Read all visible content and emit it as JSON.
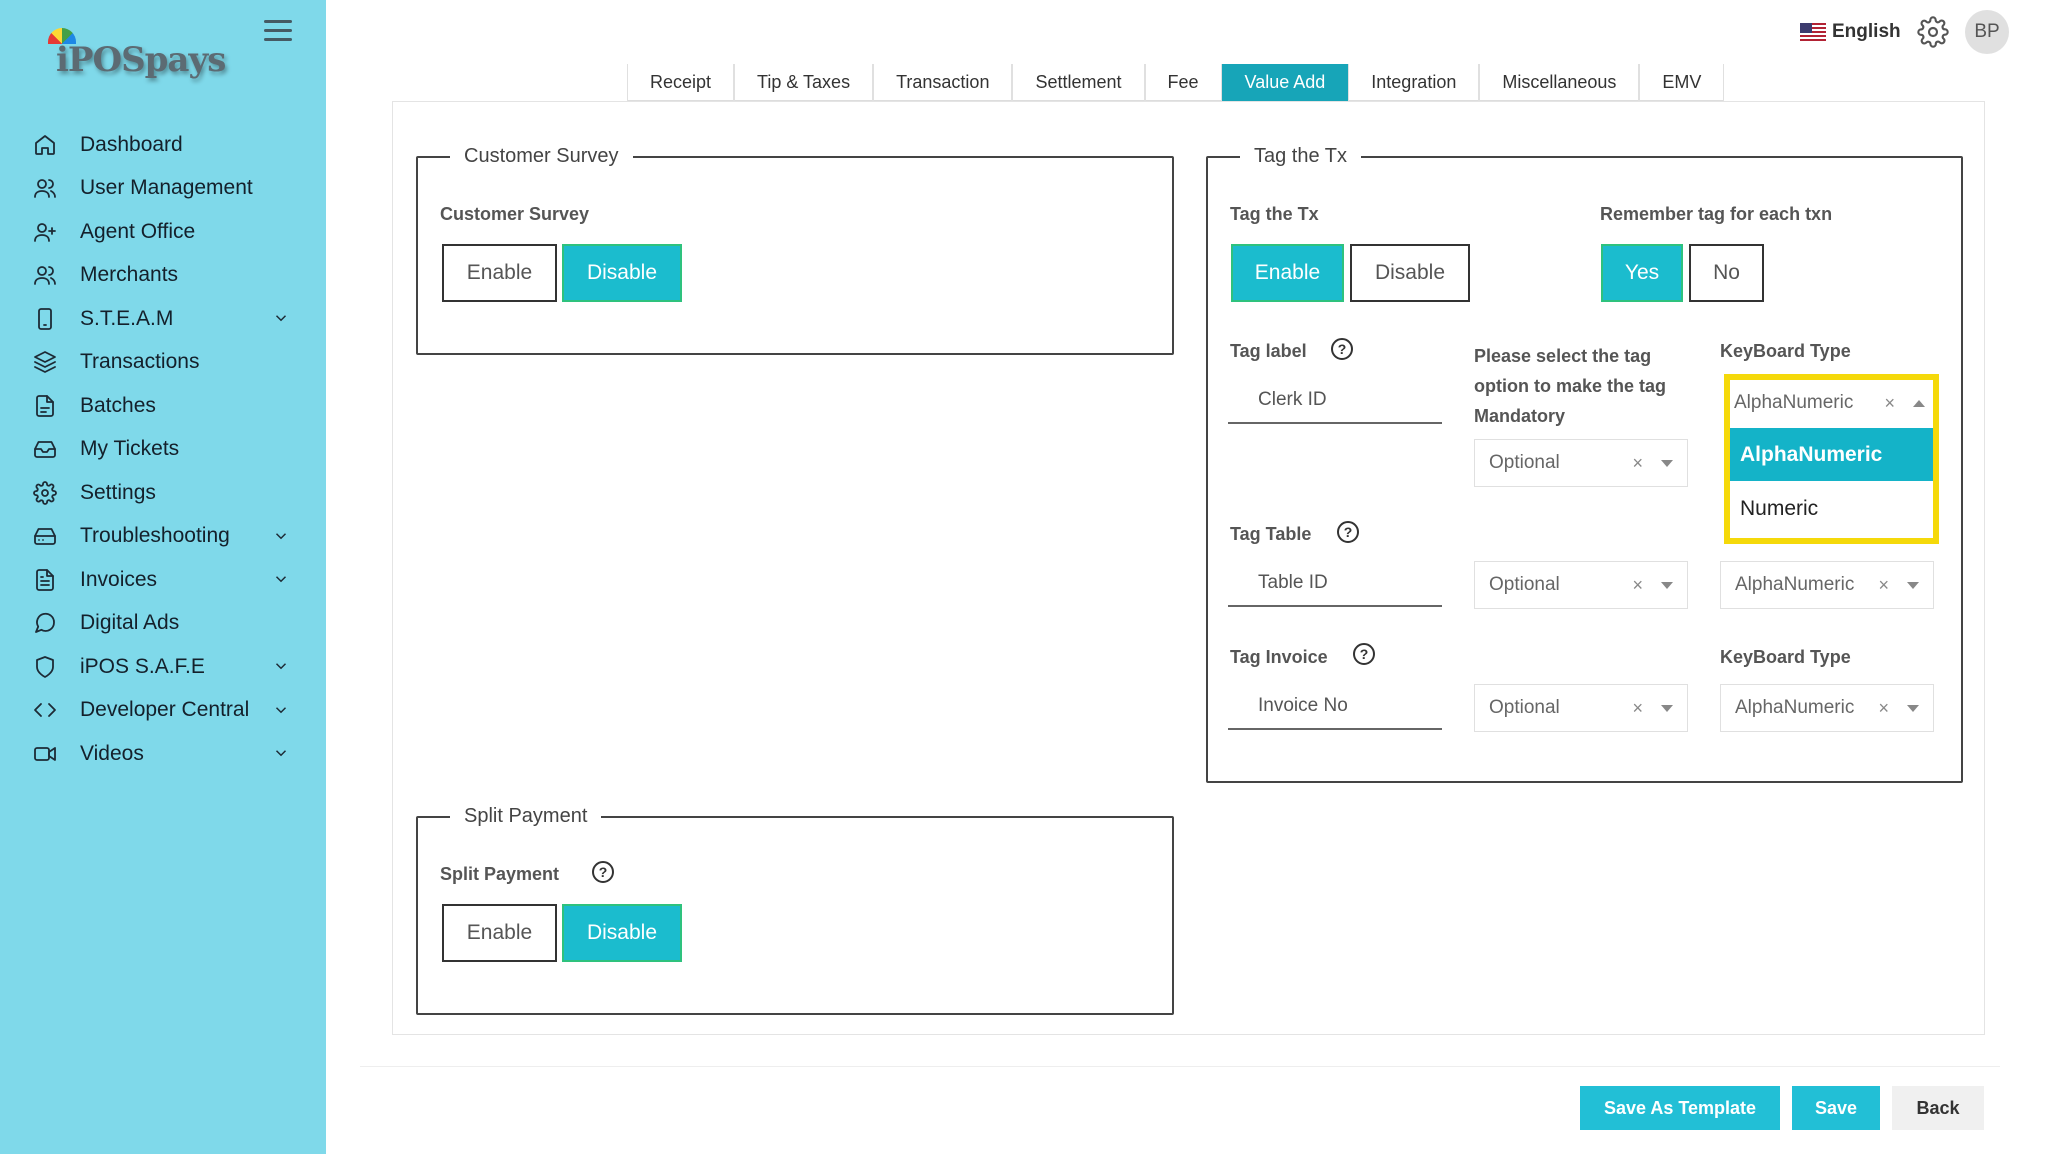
{
  "brand": {
    "logo_text": "iPOSpays"
  },
  "sidebar": {
    "items": [
      {
        "label": "Dashboard",
        "icon": "home-icon"
      },
      {
        "label": "User Management",
        "icon": "users-icon"
      },
      {
        "label": "Agent Office",
        "icon": "user-plus-icon"
      },
      {
        "label": "Merchants",
        "icon": "users-icon"
      },
      {
        "label": "S.T.E.A.M",
        "icon": "phone-icon",
        "has_children": true
      },
      {
        "label": "Transactions",
        "icon": "layers-icon"
      },
      {
        "label": "Batches",
        "icon": "file-icon"
      },
      {
        "label": "My Tickets",
        "icon": "inbox-icon"
      },
      {
        "label": "Settings",
        "icon": "gear-icon"
      },
      {
        "label": "Troubleshooting",
        "icon": "hard-drive-icon",
        "has_children": true
      },
      {
        "label": "Invoices",
        "icon": "file-text-icon",
        "has_children": true
      },
      {
        "label": "Digital Ads",
        "icon": "message-circle-icon"
      },
      {
        "label": "iPOS S.A.F.E",
        "icon": "shield-icon",
        "has_children": true
      },
      {
        "label": "Developer Central",
        "icon": "code-icon",
        "has_children": true
      },
      {
        "label": "Videos",
        "icon": "video-icon",
        "has_children": true
      }
    ]
  },
  "topbar": {
    "language": "English",
    "avatar_initials": "BP"
  },
  "tabs": [
    {
      "label": "Receipt"
    },
    {
      "label": "Tip & Taxes"
    },
    {
      "label": "Transaction"
    },
    {
      "label": "Settlement"
    },
    {
      "label": "Fee"
    },
    {
      "label": "Value Add",
      "active": true
    },
    {
      "label": "Integration"
    },
    {
      "label": "Miscellaneous"
    },
    {
      "label": "EMV"
    }
  ],
  "customer_survey": {
    "legend": "Customer Survey",
    "label": "Customer Survey",
    "enable": "Enable",
    "disable": "Disable",
    "selected": "Disable"
  },
  "split_payment": {
    "legend": "Split Payment",
    "label": "Split Payment",
    "enable": "Enable",
    "disable": "Disable",
    "selected": "Disable"
  },
  "tag_tx": {
    "legend": "Tag the Tx",
    "label": "Tag the Tx",
    "enable": "Enable",
    "disable": "Disable",
    "selected": "Enable",
    "remember_label": "Remember tag for each txn",
    "yes": "Yes",
    "no": "No",
    "remember_selected": "Yes",
    "tag_label": "Tag label",
    "tag_label_value": "Clerk ID",
    "mandatory_label": "Please select the tag option to make the tag Mandatory",
    "keyboard_label": "KeyBoard Type",
    "label_optional": "Optional",
    "label_keyboard": "AlphaNumeric",
    "tag_table": "Tag Table",
    "tag_table_value": "Table ID",
    "table_optional": "Optional",
    "table_keyboard": "AlphaNumeric",
    "tag_invoice": "Tag Invoice",
    "tag_invoice_value": "Invoice No",
    "invoice_keyboard_label": "KeyBoard Type",
    "invoice_optional": "Optional",
    "invoice_keyboard": "AlphaNumeric",
    "clear_glyph": "×",
    "dropdown_options": [
      "AlphaNumeric",
      "Numeric"
    ],
    "dropdown_selected": "AlphaNumeric"
  },
  "footer": {
    "save_template": "Save As Template",
    "save": "Save",
    "back": "Back"
  },
  "colors": {
    "sidebar_bg": "#7fd9ea",
    "accent": "#1bbcce",
    "active_tab": "#17a5b8",
    "highlight": "#f5d90a"
  }
}
